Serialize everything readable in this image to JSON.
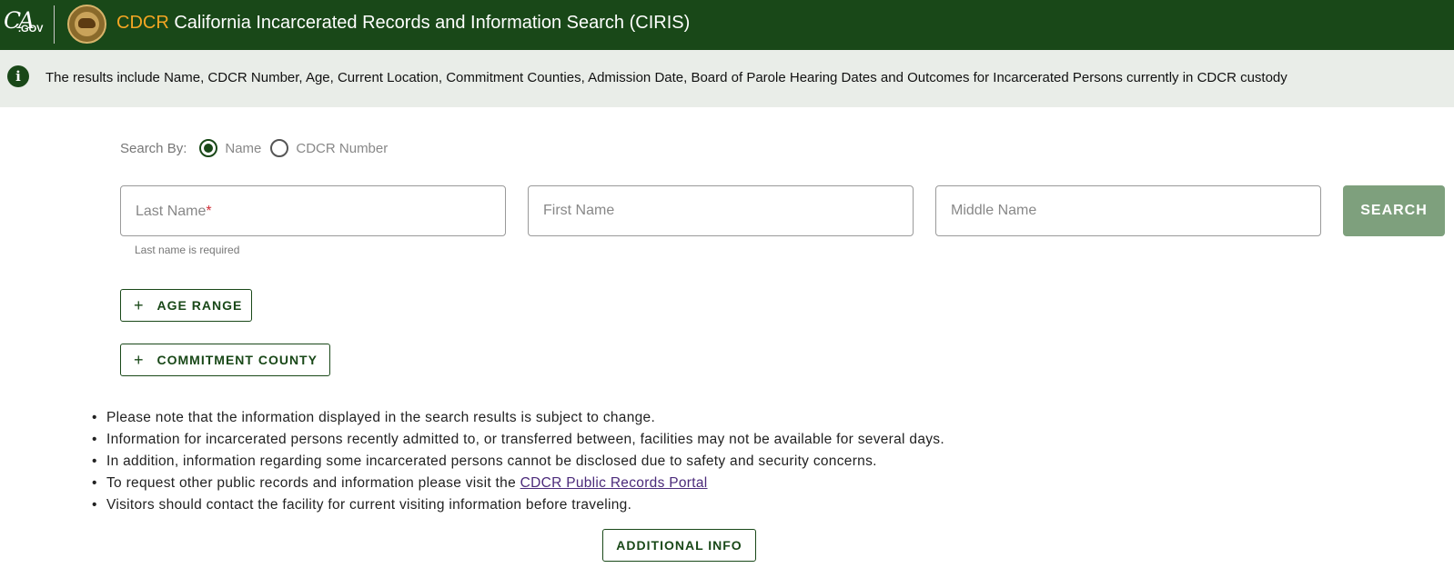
{
  "header": {
    "logo_ca": "CA",
    "logo_gov": ".GOV",
    "title_acronym": "CDCR",
    "title_rest": " California Incarcerated Records and Information Search (CIRIS)"
  },
  "info_banner": {
    "icon": "info-icon",
    "text": "The results include Name, CDCR Number, Age, Current Location, Commitment Counties, Admission Date, Board of Parole Hearing Dates and Outcomes for Incarcerated Persons currently in CDCR custody"
  },
  "search_by": {
    "label": "Search By:",
    "options": [
      {
        "label": "Name",
        "selected": true
      },
      {
        "label": "CDCR Number",
        "selected": false
      }
    ]
  },
  "fields": {
    "last_name": {
      "placeholder": "Last Name",
      "required_mark": "*",
      "value": "",
      "hint": "Last name is required"
    },
    "first_name": {
      "placeholder": "First Name",
      "value": ""
    },
    "middle_name": {
      "placeholder": "Middle Name",
      "value": ""
    }
  },
  "buttons": {
    "search": "SEARCH",
    "age_range": "AGE RANGE",
    "commitment_county": "COMMITMENT COUNTY",
    "additional_info": "ADDITIONAL INFO",
    "plus_icon": "+"
  },
  "notes": [
    {
      "text": "Please note that the information displayed in the search results is subject to change."
    },
    {
      "text": "Information for incarcerated persons recently admitted to, or transferred between, facilities may not be available for several days."
    },
    {
      "text": "In addition, information regarding some incarcerated persons cannot be disclosed due to safety and security concerns."
    },
    {
      "text": "To request other public records and information please visit the ",
      "link": "CDCR Public Records Portal"
    },
    {
      "text": "Visitors should contact the facility for current visiting information before traveling."
    }
  ],
  "colors": {
    "header_bg": "#194818",
    "acronym": "#f5a623",
    "banner_bg": "#e9ede8",
    "search_btn_bg": "#7ea07d",
    "link": "#4b2a7a"
  }
}
